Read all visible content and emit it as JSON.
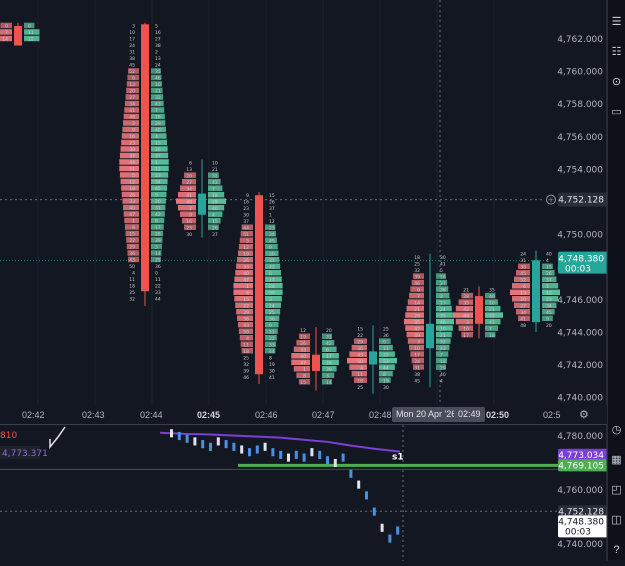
{
  "main_chart": {
    "y_ticks": [
      "4,762.000",
      "4,760.000",
      "4,758.000",
      "4,756.000",
      "4,754.000",
      "4,752.000",
      "4,750.000",
      "4,748.000",
      "4,746.000",
      "4,744.000",
      "4,742.000",
      "4,740.000"
    ],
    "crosshair_price": "4,752.128",
    "last_price": "4,748.380",
    "countdown": "00:03",
    "time_labels": [
      {
        "text": "02:42",
        "bold": false
      },
      {
        "text": "02:43",
        "bold": false
      },
      {
        "text": "02:44",
        "bold": false
      },
      {
        "text": "02:45",
        "bold": true
      },
      {
        "text": "02:46",
        "bold": false
      },
      {
        "text": "02:47",
        "bold": false
      },
      {
        "text": "02:48",
        "bold": false
      },
      {
        "text": "02:50",
        "bold": true
      },
      {
        "text": "02:5",
        "bold": false
      }
    ],
    "cursor_date": "Mon 20 Apr '26",
    "cursor_time": "02:49",
    "colors": {
      "up": "#26a69a",
      "down": "#ef5350",
      "cell_up": "#5cc7a0",
      "cell_down": "#f07a80",
      "bg": "#131722"
    }
  },
  "chart_data": [
    {
      "type": "table",
      "title": "",
      "description_values": "footprint candles (price vs time) for 02:42–02:50",
      "candles": [
        {
          "time": "02:42",
          "open": 4762.8,
          "high": 4763.0,
          "low": 4761.6,
          "close": 4761.6
        },
        {
          "time": "02:43",
          "open": 4762.9,
          "high": 4763.0,
          "low": 4745.6,
          "close": 4746.5
        },
        {
          "time": "02:44",
          "open": 4751.2,
          "high": 4754.6,
          "low": 4749.8,
          "close": 4752.5
        },
        {
          "time": "02:45",
          "open": 4752.4,
          "high": 4752.6,
          "low": 4740.8,
          "close": 4741.4
        },
        {
          "time": "02:46",
          "open": 4742.6,
          "high": 4744.3,
          "low": 4740.4,
          "close": 4741.6
        },
        {
          "time": "02:47",
          "open": 4742.0,
          "high": 4744.4,
          "low": 4740.2,
          "close": 4742.8
        },
        {
          "time": "02:48",
          "open": 4743.0,
          "high": 4748.8,
          "low": 4740.6,
          "close": 4744.5
        },
        {
          "time": "02:49",
          "open": 4746.2,
          "high": 4746.8,
          "low": 4743.6,
          "close": 4744.5
        },
        {
          "time": "02:50",
          "open": 4744.6,
          "high": 4749.0,
          "low": 4744.0,
          "close": 4748.4
        }
      ],
      "ylim": [
        4739.6,
        4763.2
      ]
    },
    {
      "type": "line",
      "title": "",
      "series": [
        {
          "name": "",
          "values": [
            4781.2,
            4780.8,
            4780.6,
            4780.2,
            4779.8,
            4779.4,
            4778.6,
            4777.8,
            4776.4,
            4775.2,
            4774.2
          ]
        }
      ],
      "ylim": [
        4738.0,
        4784.0
      ]
    }
  ],
  "sub_chart": {
    "label_partial": "810",
    "left_value": "4,773.371",
    "y_ticks": [
      "4,780.000",
      "4,760.000",
      "4,740.000"
    ],
    "tag_purple": "4,773.034",
    "tag_green": "4,769.105",
    "tag_cross": "4,752.128",
    "tag_last": "4,748.380",
    "tag_countdown": "00:03",
    "marker": "s1",
    "colors": {
      "purple": "#7b3fd8",
      "green": "#4caf50",
      "candle": "#4a90e2"
    }
  }
}
